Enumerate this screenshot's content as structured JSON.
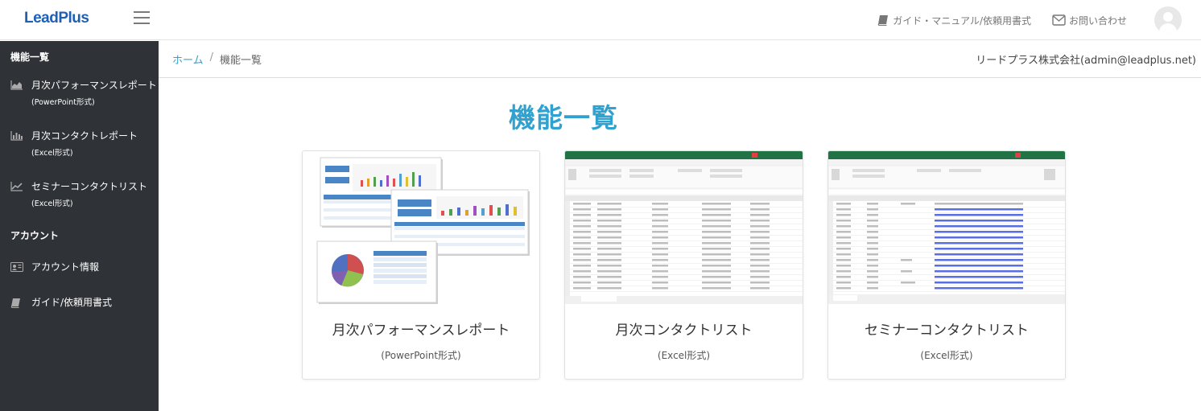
{
  "header": {
    "logo": "LeadPlus",
    "guide_link": "ガイド・マニュアル/依頼用書式",
    "contact_link": "お問い合わせ"
  },
  "sidebar": {
    "section1": "機能一覧",
    "items1": [
      {
        "label": "月次パフォーマンスレポート",
        "sub": "(PowerPoint形式)",
        "icon": "area-chart-icon"
      },
      {
        "label": "月次コンタクトレポート",
        "sub": "(Excel形式)",
        "icon": "bar-chart-icon"
      },
      {
        "label": "セミナーコンタクトリスト",
        "sub": "(Excel形式)",
        "icon": "line-chart-icon"
      }
    ],
    "section2": "アカウント",
    "items2": [
      {
        "label": "アカウント情報",
        "icon": "id-card-icon"
      },
      {
        "label": "ガイド/依頼用書式",
        "icon": "book-icon"
      }
    ]
  },
  "breadcrumb": {
    "home": "ホーム",
    "separator": "/",
    "current": "機能一覧"
  },
  "company": "リードプラス株式会社(admin@leadplus.net)",
  "main": {
    "title": "機能一覧",
    "cards": [
      {
        "title": "月次パフォーマンスレポート",
        "format": "(PowerPoint形式)"
      },
      {
        "title": "月次コンタクトリスト",
        "format": "(Excel形式)"
      },
      {
        "title": "セミナーコンタクトリスト",
        "format": "(Excel形式)"
      }
    ]
  },
  "colors": {
    "accent": "#31a2cf",
    "link": "#3ba0c4",
    "sidebar_bg": "#2f3236",
    "logo": "#1f5fb4",
    "excel_green": "#217346"
  }
}
